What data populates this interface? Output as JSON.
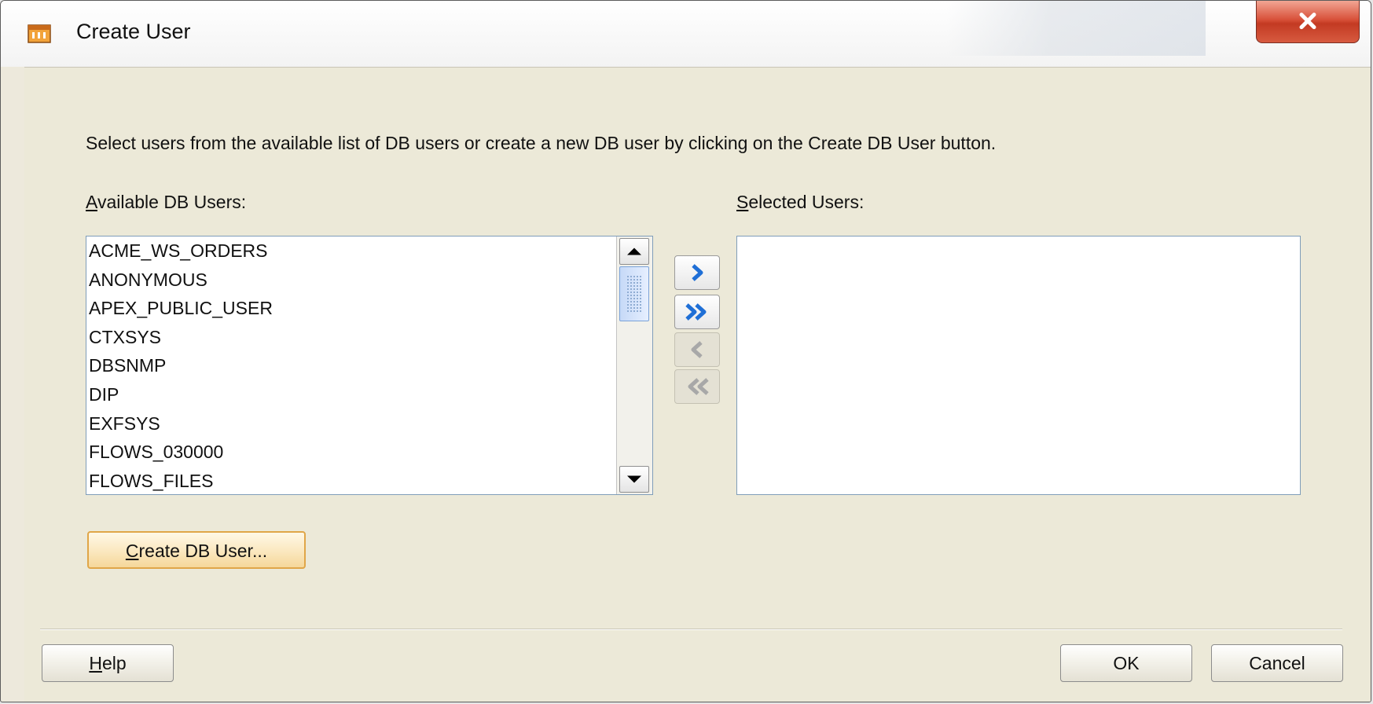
{
  "window": {
    "title": "Create User"
  },
  "instructions": "Select users from the available list of DB users or create a new DB user by clicking on the Create DB User button.",
  "available": {
    "label_mnemonic": "A",
    "label_rest": "vailable DB Users:",
    "items": [
      "ACME_WS_ORDERS",
      "ANONYMOUS",
      "APEX_PUBLIC_USER",
      "CTXSYS",
      "DBSNMP",
      "DIP",
      "EXFSYS",
      "FLOWS_030000",
      "FLOWS_FILES"
    ]
  },
  "selected": {
    "label_mnemonic": "S",
    "label_rest": "elected Users:",
    "items": []
  },
  "shuttle": {
    "move_right": "move-right-icon",
    "move_all_right": "move-all-right-icon",
    "move_left": "move-left-icon",
    "move_all_left": "move-all-left-icon"
  },
  "buttons": {
    "create_db_user_mnemonic": "C",
    "create_db_user_rest": "reate DB User...",
    "help_mnemonic": "H",
    "help_rest": "elp",
    "ok": "OK",
    "cancel": "Cancel"
  },
  "colors": {
    "dialog_background": "#ece9d8",
    "close_button": "#c33a22",
    "focus_button_border": "#e0a648",
    "shuttle_arrow": "#1f6fd6",
    "shuttle_arrow_disabled": "#a8a8a8"
  }
}
